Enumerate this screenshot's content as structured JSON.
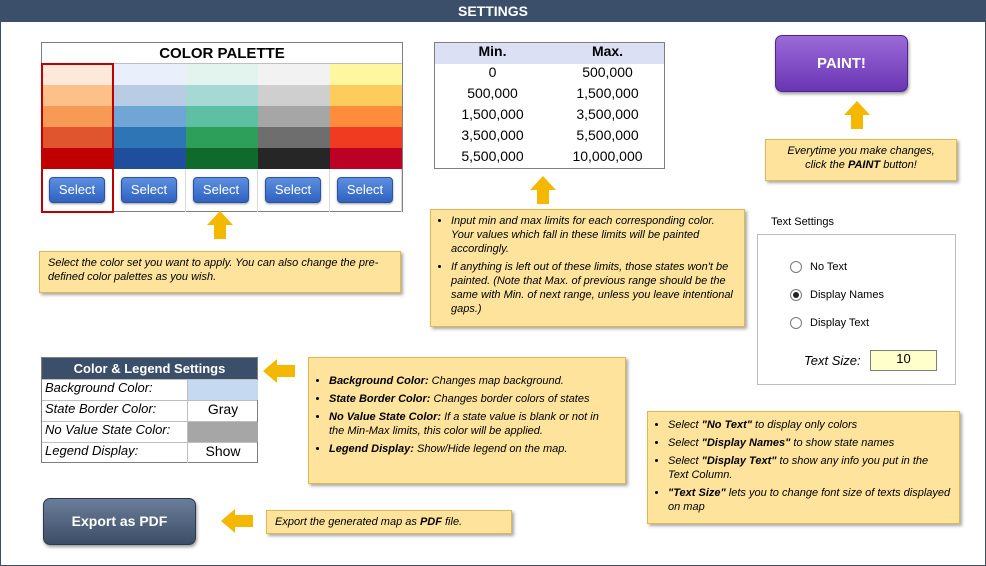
{
  "header": {
    "title": "SETTINGS"
  },
  "palette": {
    "title": "COLOR PALETTE",
    "select_label": "Select",
    "selected_index": 0,
    "columns": [
      [
        "#fde9d9",
        "#fcc088",
        "#f79a55",
        "#e0542e",
        "#c00000"
      ],
      [
        "#e9effb",
        "#b8cce4",
        "#6fa6d6",
        "#2e75b6",
        "#1f4e9c"
      ],
      [
        "#e3f3ee",
        "#a6d9d4",
        "#5fbfa2",
        "#2e9f5a",
        "#0e6b2b"
      ],
      [
        "#f2f2f2",
        "#cfcfcf",
        "#a6a6a6",
        "#6e6e6e",
        "#262626"
      ],
      [
        "#fef79f",
        "#fecc5c",
        "#fd8d3c",
        "#f03b20",
        "#bd0026"
      ]
    ]
  },
  "notes": {
    "palette": "Select the color set you want to apply. You can also change the pre-defined color palettes as you wish.",
    "limits": [
      "Input min and max limits for each corresponding color. Your values which fall in these limits will be painted accordingly.",
      "If anything is left out of these limits, those states won't be painted. (Note that Max. of previous range should be the same with Min. of next range, unless you leave intentional gaps.)"
    ],
    "paint": {
      "line1": "Everytime you make changes,",
      "line2_pre": "click the ",
      "line2_bold": "PAINT",
      "line2_post": " button!"
    },
    "legend": [
      {
        "bold": "Background Color:",
        "text": " Changes map background."
      },
      {
        "bold": "State Border Color:",
        "text": " Changes border colors of states"
      },
      {
        "bold": "No Value State Color:",
        "text": " If a state value is blank or not in the Min-Max limits, this color will be applied."
      },
      {
        "bold": "Legend Display:",
        "text": " Show/Hide legend on the map."
      }
    ],
    "text": [
      {
        "pre": "Select ",
        "bold": "\"No Text\"",
        "post": " to display only colors"
      },
      {
        "pre": "Select ",
        "bold": "\"Display Names\"",
        "post": " to show state names"
      },
      {
        "pre": "Select ",
        "bold": "\"Display Text\"",
        "post": " to show any info you put in the Text Column."
      },
      {
        "pre": "",
        "bold": "\"Text Size\"",
        "post": " lets you to change font size of texts displayed on map"
      }
    ],
    "export": {
      "pre": "Export the generated map as ",
      "bold": "PDF",
      "post": " file."
    }
  },
  "limits": {
    "min_header": "Min.",
    "max_header": "Max.",
    "rows": [
      [
        "0",
        "500,000"
      ],
      [
        "500,000",
        "1,500,000"
      ],
      [
        "1,500,000",
        "3,500,000"
      ],
      [
        "3,500,000",
        "5,500,000"
      ],
      [
        "5,500,000",
        "10,000,000"
      ]
    ]
  },
  "paint_button": {
    "label": "PAINT!"
  },
  "legend_settings": {
    "title": "Color & Legend Settings",
    "rows": [
      {
        "label": "Background Color:",
        "value": "",
        "swatch": "#c5daf0"
      },
      {
        "label": "State Border Color:",
        "value": "Gray",
        "swatch": ""
      },
      {
        "label": "No Value State Color:",
        "value": "",
        "swatch": "#a6a6a6"
      },
      {
        "label": "Legend Display:",
        "value": "Show",
        "swatch": ""
      }
    ]
  },
  "export_button": {
    "label": "Export as PDF"
  },
  "text_settings": {
    "title": "Text Settings",
    "options": [
      {
        "label": "No Text",
        "checked": false
      },
      {
        "label": "Display Names",
        "checked": true
      },
      {
        "label": "Display Text",
        "checked": false
      }
    ],
    "size_label": "Text Size:",
    "size_value": "10"
  }
}
